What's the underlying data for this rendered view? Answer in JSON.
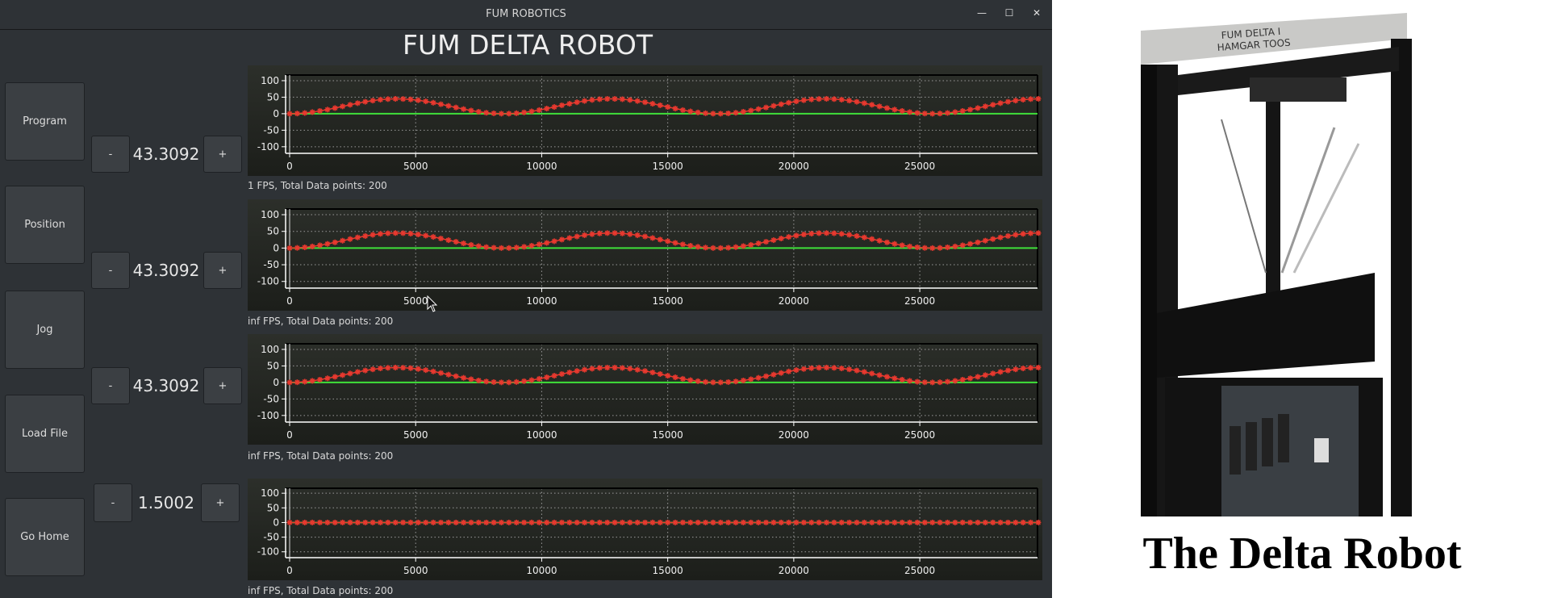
{
  "window": {
    "title": "FUM ROBOTICS",
    "controls": {
      "minimize": "—",
      "maximize": "☐",
      "close": "✕"
    }
  },
  "heading": "FUM DELTA ROBOT",
  "sidebar": {
    "buttons": [
      {
        "label": "Program"
      },
      {
        "label": "Position"
      },
      {
        "label": "Jog"
      },
      {
        "label": "Load File"
      },
      {
        "label": "Go Home"
      }
    ]
  },
  "steppers": [
    {
      "minus": "-",
      "value": "43.3092",
      "plus": "+"
    },
    {
      "minus": "-",
      "value": "43.3092",
      "plus": "+"
    },
    {
      "minus": "-",
      "value": "43.3092",
      "plus": "+"
    },
    {
      "minus": "-",
      "value": "1.5002",
      "plus": "+"
    }
  ],
  "status_lines": [
    "1 FPS, Total Data points: 200",
    "inf FPS, Total Data points: 200",
    "inf FPS, Total Data points: 200",
    "inf FPS, Total Data points: 200"
  ],
  "colors": {
    "series": "#e8392f",
    "zero_line": "#3fe03a",
    "window_bg": "#2e3236",
    "plot_bg": "#23261f"
  },
  "chart_data": [
    {
      "type": "line",
      "grid": true,
      "xlim": [
        -160,
        29670
      ],
      "ylim": [
        -120,
        117
      ],
      "xticks": [
        "0",
        "5000",
        "10000",
        "15000",
        "20000",
        "25000"
      ],
      "yticks": [
        "100",
        "50",
        "0",
        "-50",
        "-100"
      ],
      "x_step": 300,
      "series": [
        {
          "values": [
            0,
            0.6,
            2.2,
            4.8,
            8.3,
            12.5,
            17.1,
            22.1,
            27.0,
            31.8,
            36.1,
            39.7,
            42.5,
            44.3,
            45.0,
            44.6,
            43.2,
            40.7,
            37.3,
            33.3,
            28.7,
            23.7,
            18.8,
            14.0,
            9.6,
            5.9,
            2.9,
            1.0,
            0.1,
            0.2,
            1.5,
            3.8,
            7.0,
            11.0,
            15.5,
            20.4,
            25.4,
            30.2,
            34.7,
            38.6,
            41.6,
            43.8,
            44.9,
            44.9,
            43.8,
            41.6,
            38.5,
            34.7,
            30.2,
            25.4,
            20.4,
            15.5,
            11.0,
            7.0,
            3.8,
            1.5,
            0.2,
            0.1,
            1.0,
            2.9,
            5.9,
            9.6,
            14.0,
            18.8,
            23.7,
            28.7,
            33.3,
            37.4,
            40.7,
            43.2,
            44.6,
            45.0,
            44.3,
            42.5,
            39.7,
            36.1,
            31.8,
            27.0,
            22.1,
            17.1,
            12.5,
            8.3,
            4.8,
            2.2,
            0.5,
            0,
            0.6,
            2.2,
            4.8,
            8.3,
            12.5,
            17.1,
            22.1,
            27.0,
            31.8,
            36.1,
            39.7,
            42.5,
            44.3,
            45.0
          ]
        }
      ]
    },
    {
      "type": "line",
      "grid": true,
      "xlim": [
        -160,
        29670
      ],
      "ylim": [
        -120,
        117
      ],
      "xticks": [
        "0",
        "5000",
        "10000",
        "15000",
        "20000",
        "25000"
      ],
      "yticks": [
        "100",
        "50",
        "0",
        "-50",
        "-100"
      ],
      "x_step": 300,
      "series": [
        {
          "values": [
            0,
            0.6,
            2.2,
            4.8,
            8.3,
            12.5,
            17.1,
            22.1,
            27.0,
            31.8,
            36.1,
            39.7,
            42.5,
            44.3,
            45.0,
            44.6,
            43.2,
            40.7,
            37.3,
            33.3,
            28.7,
            23.7,
            18.8,
            14.0,
            9.6,
            5.9,
            2.9,
            1.0,
            0.1,
            0.2,
            1.5,
            3.8,
            7.0,
            11.0,
            15.5,
            20.4,
            25.4,
            30.2,
            34.7,
            38.6,
            41.6,
            43.8,
            44.9,
            44.9,
            43.8,
            41.6,
            38.5,
            34.7,
            30.2,
            25.4,
            20.4,
            15.5,
            11.0,
            7.0,
            3.8,
            1.5,
            0.2,
            0.1,
            1.0,
            2.9,
            5.9,
            9.6,
            14.0,
            18.8,
            23.7,
            28.7,
            33.3,
            37.4,
            40.7,
            43.2,
            44.6,
            45.0,
            44.3,
            42.5,
            39.7,
            36.1,
            31.8,
            27.0,
            22.1,
            17.1,
            12.5,
            8.3,
            4.8,
            2.2,
            0.5,
            0,
            0.6,
            2.2,
            4.8,
            8.3,
            12.5,
            17.1,
            22.1,
            27.0,
            31.8,
            36.1,
            39.7,
            42.5,
            44.3,
            45.0
          ]
        }
      ]
    },
    {
      "type": "line",
      "grid": true,
      "xlim": [
        -160,
        29670
      ],
      "ylim": [
        -120,
        117
      ],
      "xticks": [
        "0",
        "5000",
        "10000",
        "15000",
        "20000",
        "25000"
      ],
      "yticks": [
        "100",
        "50",
        "0",
        "-50",
        "-100"
      ],
      "x_step": 300,
      "series": [
        {
          "values": [
            0,
            0.6,
            2.2,
            4.8,
            8.3,
            12.5,
            17.1,
            22.1,
            27.0,
            31.8,
            36.1,
            39.7,
            42.5,
            44.3,
            45.0,
            44.6,
            43.2,
            40.7,
            37.3,
            33.3,
            28.7,
            23.7,
            18.8,
            14.0,
            9.6,
            5.9,
            2.9,
            1.0,
            0.1,
            0.2,
            1.5,
            3.8,
            7.0,
            11.0,
            15.5,
            20.4,
            25.4,
            30.2,
            34.7,
            38.6,
            41.6,
            43.8,
            44.9,
            44.9,
            43.8,
            41.6,
            38.5,
            34.7,
            30.2,
            25.4,
            20.4,
            15.5,
            11.0,
            7.0,
            3.8,
            1.5,
            0.2,
            0.1,
            1.0,
            2.9,
            5.9,
            9.6,
            14.0,
            18.8,
            23.7,
            28.7,
            33.3,
            37.4,
            40.7,
            43.2,
            44.6,
            45.0,
            44.3,
            42.5,
            39.7,
            36.1,
            31.8,
            27.0,
            22.1,
            17.1,
            12.5,
            8.3,
            4.8,
            2.2,
            0.5,
            0,
            0.6,
            2.2,
            4.8,
            8.3,
            12.5,
            17.1,
            22.1,
            27.0,
            31.8,
            36.1,
            39.7,
            42.5,
            44.3,
            45.0
          ]
        }
      ]
    },
    {
      "type": "line",
      "grid": true,
      "xlim": [
        -160,
        29670
      ],
      "ylim": [
        -120,
        117
      ],
      "xticks": [
        "0",
        "5000",
        "10000",
        "15000",
        "20000",
        "25000"
      ],
      "yticks": [
        "100",
        "50",
        "0",
        "-50",
        "-100"
      ],
      "x_step": 300,
      "series": [
        {
          "values": [
            0,
            0,
            0,
            0,
            0,
            0,
            0,
            0,
            0,
            0,
            0,
            0,
            0,
            0,
            0,
            0,
            0,
            0,
            0,
            0,
            0,
            0,
            0,
            0,
            0,
            0,
            0,
            0,
            0,
            0,
            0,
            0,
            0,
            0,
            0,
            0,
            0,
            0,
            0,
            0,
            0,
            0,
            0,
            0,
            0,
            0,
            0,
            0,
            0,
            0,
            0,
            0,
            0,
            0,
            0,
            0,
            0,
            0,
            0,
            0,
            0,
            0,
            0,
            0,
            0,
            0,
            0,
            0,
            0,
            0,
            0,
            0,
            0,
            0,
            0,
            0,
            0,
            0,
            0,
            0,
            0,
            0,
            0,
            0,
            0,
            0,
            0,
            0,
            0,
            0,
            0,
            0,
            0,
            0,
            0,
            0,
            0,
            0,
            0,
            0
          ]
        }
      ]
    }
  ],
  "photo": {
    "logo_text": [
      "FUM DELTA I",
      "HAMGAR TOOS"
    ],
    "caption": "The Delta Robot"
  }
}
